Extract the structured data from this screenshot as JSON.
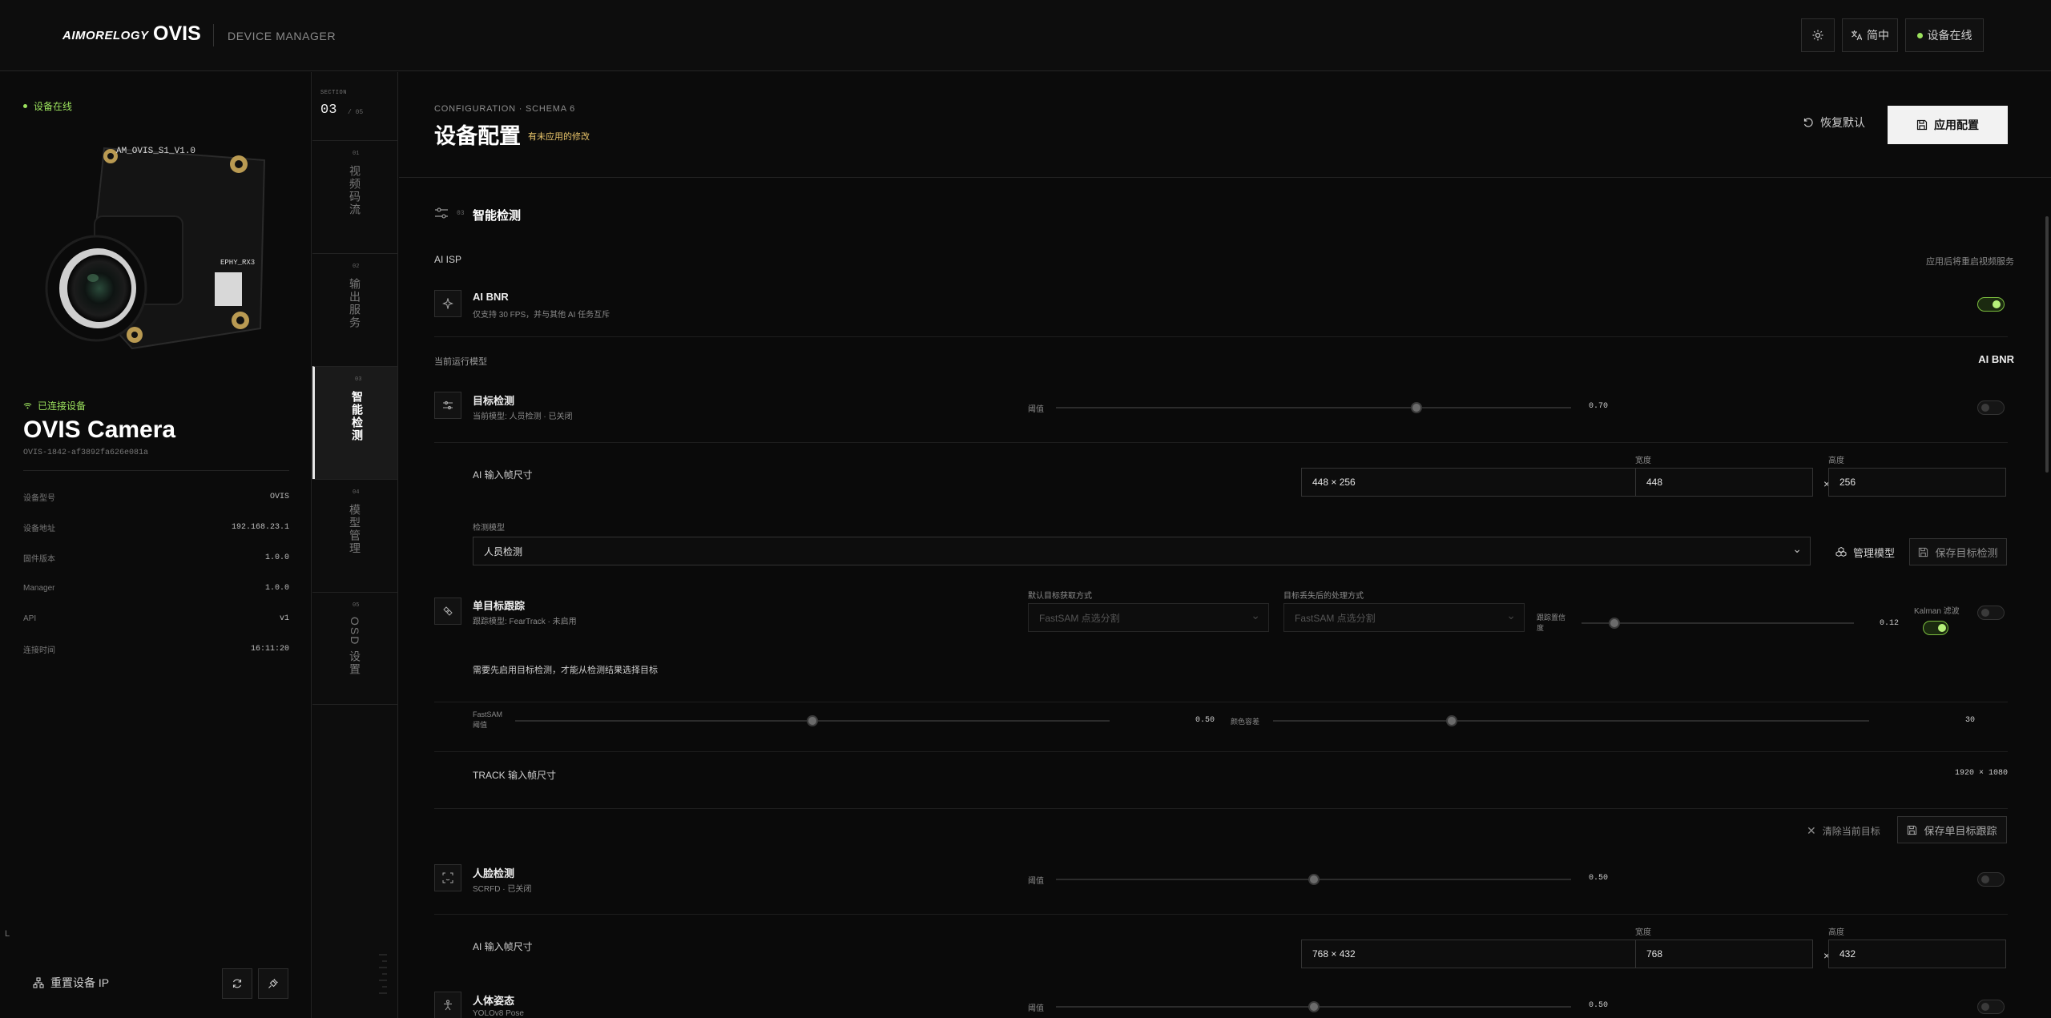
{
  "header": {
    "logo_text": "AIMORELOGY",
    "brand": "OVIS",
    "subtitle": "DEVICE MANAGER",
    "language": "简中",
    "status": "设备在线"
  },
  "sidebar": {
    "status": "设备在线",
    "connected": "已连接设备",
    "device_name": "OVIS Camera",
    "device_id": "OVIS-1842-af3892fa626e081a",
    "board_label": "AM_OVIS_S1_V1.0",
    "info": [
      {
        "key": "设备型号",
        "value": "OVIS"
      },
      {
        "key": "设备地址",
        "value": "192.168.23.1"
      },
      {
        "key": "固件版本",
        "value": "1.0.0"
      },
      {
        "key": "Manager",
        "value": "1.0.0"
      },
      {
        "key": "API",
        "value": "v1"
      },
      {
        "key": "连接时间",
        "value": "16:11:20"
      }
    ],
    "reset_ip": "重置设备 IP"
  },
  "rail": {
    "header": "SECTION",
    "current": "03",
    "total": "/ 05",
    "items": [
      {
        "index": "01",
        "label": "视频码流"
      },
      {
        "index": "02",
        "label": "输出服务"
      },
      {
        "index": "03",
        "label": "智能检测"
      },
      {
        "index": "04",
        "label": "模型管理"
      },
      {
        "index": "05",
        "label": "OSD 设置"
      }
    ]
  },
  "main": {
    "schema": "CONFIGURATION · SCHEMA 6",
    "title": "设备配置",
    "unsaved": "有未应用的修改",
    "restore": "恢复默认",
    "apply": "应用配置",
    "section_index": "03",
    "section_title": "智能检测",
    "ai_isp": "AI ISP",
    "restart_note": "应用后将重启视频服务",
    "bnr": {
      "title": "AI BNR",
      "desc": "仅支持 30 FPS，并与其他 AI 任务互斥",
      "enabled": true
    },
    "current_model_label": "当前运行模型",
    "current_model_value": "AI BNR",
    "object_detect": {
      "title": "目标检测",
      "desc": "当前模型: 人员检测 · 已关闭",
      "threshold_label": "阈值",
      "threshold": "0.70",
      "threshold_level": 0.7,
      "enabled": false,
      "input_size_label": "AI 输入帧尺寸",
      "size_option": "448 × 256",
      "width_label": "宽度",
      "width": "448",
      "height_label": "高度",
      "height": "256",
      "model_label": "检测模型",
      "model": "人员检测",
      "manage_models": "管理模型",
      "save": "保存目标检测"
    },
    "single_track": {
      "title": "单目标跟踪",
      "desc": "跟踪模型: FearTrack · 未启用",
      "default_method_label": "默认目标获取方式",
      "default_method": "FastSAM 点选分割",
      "lost_method_label": "目标丢失后的处理方式",
      "lost_method": "FastSAM 点选分割",
      "confidence_label": "跟踪置信度",
      "confidence": "0.12",
      "confidence_level": 0.12,
      "kalman_label": "Kalman 滤波",
      "kalman_enabled": true,
      "enabled": false,
      "hint": "需要先启用目标检测，才能从检测结果选择目标",
      "fastsam_label": "FastSAM 阈值",
      "fastsam": "0.50",
      "fastsam_level": 0.5,
      "color_tol_label": "颜色容差",
      "color_tol": "30",
      "color_tol_level": 0.3,
      "track_size_label": "TRACK 输入帧尺寸",
      "track_size": "1920 × 1080",
      "clear": "清除当前目标",
      "save": "保存单目标跟踪"
    },
    "face_detect": {
      "title": "人脸检测",
      "desc": "SCRFD · 已关闭",
      "threshold_label": "阈值",
      "threshold": "0.50",
      "threshold_level": 0.5,
      "enabled": false,
      "input_size_label": "AI 输入帧尺寸",
      "size_option": "768 × 432",
      "width_label": "宽度",
      "width": "768",
      "height_label": "高度",
      "height": "432"
    },
    "pose": {
      "title": "人体姿态",
      "desc": "YOLOv8 Pose",
      "threshold_label": "阈值",
      "threshold": "0.50",
      "threshold_level": 0.5,
      "enabled": false
    }
  }
}
